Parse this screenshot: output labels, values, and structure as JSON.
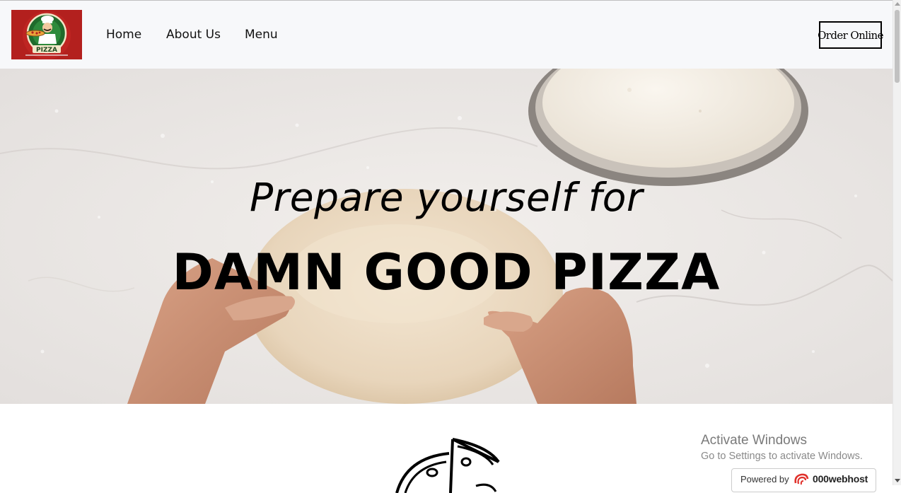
{
  "navbar": {
    "logo_text": "PIZZA",
    "links": [
      "Home",
      "About Us",
      "Menu"
    ],
    "order_button": "Order Online"
  },
  "hero": {
    "subtitle": "Prepare yourself for",
    "title": "DAMN GOOD PIZZA"
  },
  "watermark": {
    "title": "Activate Windows",
    "subtitle": "Go to Settings to activate Windows."
  },
  "badge": {
    "label": "Powered by",
    "brand": "000webhost"
  },
  "colors": {
    "nav_bg": "#f7f8fa",
    "logo_bg": "#b3201e",
    "text": "#000000"
  },
  "icons": [
    "pizza-logo-icon",
    "pizza-slice-icon",
    "webhost-logo-icon"
  ]
}
